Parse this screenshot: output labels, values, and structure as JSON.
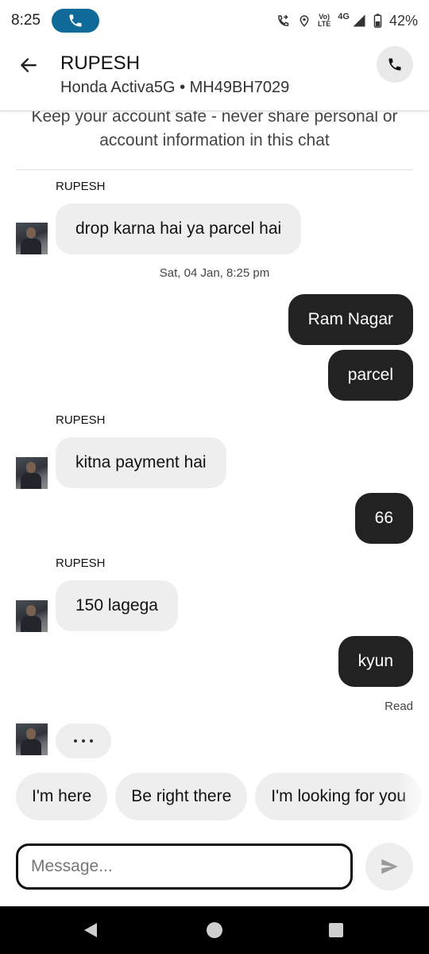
{
  "status_bar": {
    "time": "8:25",
    "battery": "42%",
    "network_top": "Vo)",
    "network_bottom": "LTE",
    "network_type": "4G"
  },
  "header": {
    "title": "RUPESH",
    "subtitle": "Honda Activa5G • MH49BH7029"
  },
  "safety_notice": "Keep your account safe - never share personal or account information in this chat",
  "messages": [
    {
      "sender": "RUPESH",
      "text": "drop karna hai ya parcel hai"
    },
    {
      "timestamp": "Sat, 04 Jan, 8:25 pm"
    },
    {
      "text": "Ram Nagar"
    },
    {
      "text": "parcel"
    },
    {
      "sender": "RUPESH",
      "text": "kitna payment hai"
    },
    {
      "text": "66"
    },
    {
      "sender": "RUPESH",
      "text": "150 lagega"
    },
    {
      "text": "kyun"
    }
  ],
  "read_receipt": "Read",
  "typing_indicator": "...",
  "quick_replies": [
    "I'm here",
    "Be right there",
    "I'm looking for you"
  ],
  "composer": {
    "placeholder": "Message..."
  },
  "colors": {
    "accent": "#0f6a99",
    "outgoing_bubble": "#222222",
    "incoming_bubble": "#eeeeee"
  }
}
